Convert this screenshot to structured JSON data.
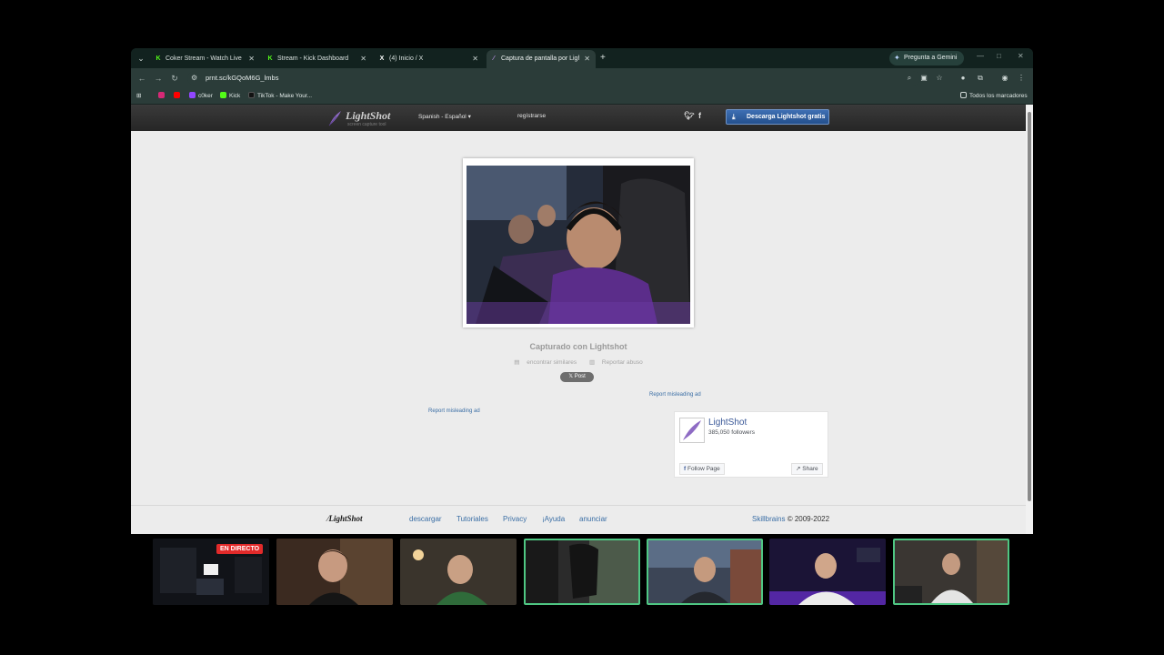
{
  "browser": {
    "tabs": [
      {
        "title": "Coker Stream - Watch Live on Kick",
        "favicon": "kick-icon",
        "active": false
      },
      {
        "title": "Stream - Kick Dashboard",
        "favicon": "kick-icon",
        "active": false
      },
      {
        "title": "(4) Inicio / X",
        "favicon": "x-icon",
        "active": false
      },
      {
        "title": "Captura de pantalla por Lightshot",
        "favicon": "lightshot-icon",
        "active": true
      }
    ],
    "new_tab": "+",
    "gemini_label": "Pregunta a Gemini",
    "url": "prnt.sc/kGQoM6G_lmbs",
    "bookmarks": [
      {
        "label": "",
        "icon": "instagram-icon",
        "color": "#d62976"
      },
      {
        "label": "",
        "icon": "youtube-icon",
        "color": "#ff0000"
      },
      {
        "label": "c0ker",
        "icon": "twitch-icon",
        "color": "#9146ff"
      },
      {
        "label": "Kick",
        "icon": "kick-icon",
        "color": "#53fc18"
      },
      {
        "label": "TikTok - Make Your...",
        "icon": "tiktok-icon",
        "color": "#111111"
      }
    ],
    "all_bookmarks": "Todos los marcadores"
  },
  "lightshot": {
    "logo_name": "LightShot",
    "logo_tagline": "screen capture tool",
    "language": "Spanish - Español",
    "register": "regístrarse",
    "download_button": "Descarga Lightshot gratis",
    "caption": "Capturado con Lightshot",
    "find_similar": "encontrar similares",
    "report_abuse": "Reportar abuso",
    "post_button": "𝕏 Post",
    "report_ad_1": "Report misleading ad",
    "report_ad_2": "Report misleading ad",
    "fb": {
      "page_name": "LightShot",
      "followers": "385,050 followers",
      "follow": "Follow Page",
      "share": "Share"
    },
    "footer": {
      "logo": "LightShot",
      "links": [
        "descargar",
        "Tutoriales",
        "Privacy",
        "¡Ayuda",
        "anunciar"
      ],
      "company": "Skillbrains",
      "years": "© 2009-2022"
    }
  },
  "stream": {
    "live_badge": "EN DIRECTO"
  },
  "colors": {
    "accent_blue": "#3a6ea5",
    "live_red": "#e22a2a",
    "cam_highlight": "#4fc783"
  }
}
